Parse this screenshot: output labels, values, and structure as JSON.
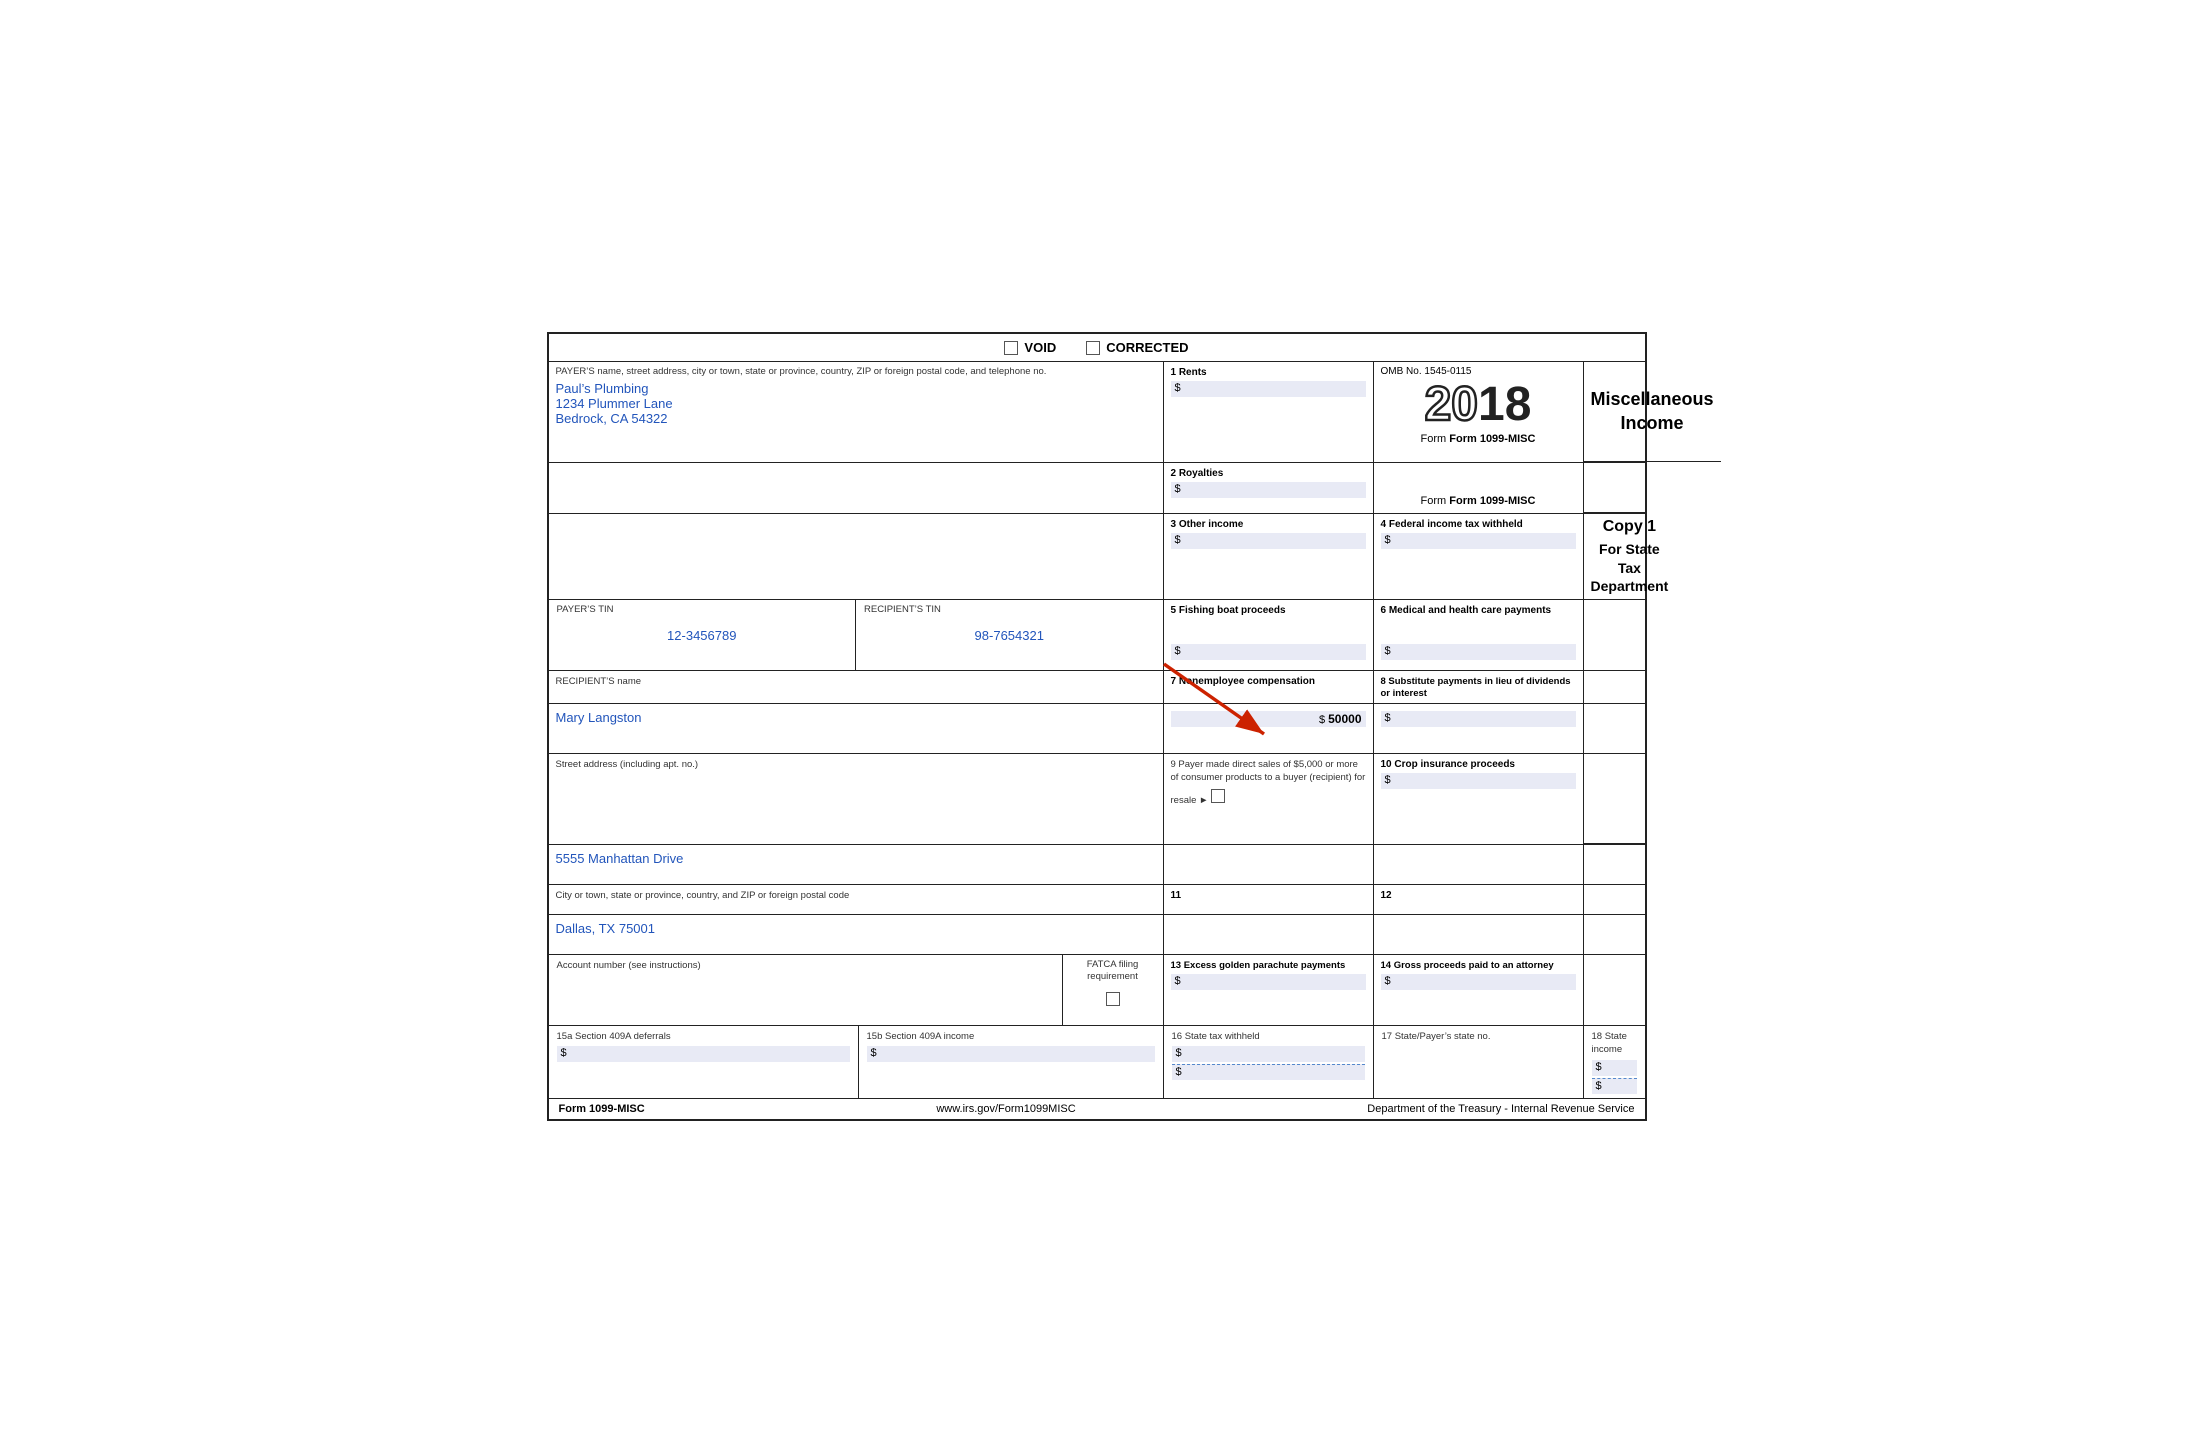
{
  "header": {
    "void_label": "VOID",
    "corrected_label": "CORRECTED"
  },
  "form": {
    "title_line1": "Miscellaneous",
    "title_line2": "Income",
    "copy_label": "Copy 1",
    "copy_sublabel": "For State Tax Department",
    "year_outline": "20",
    "year_solid": "18",
    "form_name": "Form 1099-MISC",
    "omb_label": "OMB No. 1545-0115",
    "payer_section_label": "PAYER’S name, street address, city or town, state or province, country, ZIP or foreign postal code, and telephone no.",
    "payer_name": "Paul’s Plumbing",
    "payer_address": "1234 Plummer Lane",
    "payer_city": "Bedrock, CA 54322",
    "payer_tin_label": "PAYER’S TIN",
    "payer_tin_value": "12-3456789",
    "recipient_tin_label": "RECIPIENT’S TIN",
    "recipient_tin_value": "98-7654321",
    "recipient_name_label": "RECIPIENT’S name",
    "recipient_name_value": "Mary Langston",
    "street_label": "Street address (including apt. no.)",
    "street_value": "5555 Manhattan Drive",
    "city_label": "City or town, state or province, country, and ZIP or foreign postal code",
    "city_value": "Dallas, TX 75001",
    "account_label": "Account number (see instructions)",
    "fatca_label": "FATCA filing requirement",
    "box1_label": "1 Rents",
    "box1_dollar": "$",
    "box2_label": "2 Royalties",
    "box2_dollar": "$",
    "box3_label": "3 Other income",
    "box3_dollar": "$",
    "box4_label": "4 Federal income tax withheld",
    "box4_dollar": "$",
    "box5_label": "5 Fishing boat proceeds",
    "box5_dollar": "$",
    "box6_label": "6 Medical and health care payments",
    "box6_dollar": "$",
    "box7_label": "7 Nonemployee compensation",
    "box7_dollar": "$",
    "box7_value": "50000",
    "box8_label": "8 Substitute payments in lieu of dividends or interest",
    "box8_dollar": "$",
    "box9_label": "9 Payer made direct sales of $5,000 or more of consumer products to a buyer (recipient) for resale ►",
    "box10_label": "10 Crop insurance proceeds",
    "box10_dollar": "$",
    "box11_label": "11",
    "box12_label": "12",
    "box13_label": "13 Excess golden parachute payments",
    "box13_dollar": "$",
    "box14_label": "14 Gross proceeds paid to an attorney",
    "box14_dollar": "$",
    "box15a_label": "15a Section 409A deferrals",
    "box15a_dollar": "$",
    "box15b_label": "15b Section 409A income",
    "box15b_dollar": "$",
    "box16_label": "16 State tax withheld",
    "box16_dollar1": "$",
    "box16_dollar2": "$",
    "box17_label": "17 State/Payer’s state no.",
    "box18_label": "18 State income",
    "box18_dollar1": "$",
    "box18_dollar2": "$",
    "footer_form": "Form 1099-MISC",
    "footer_url": "www.irs.gov/Form1099MISC",
    "footer_dept": "Department of the Treasury - Internal Revenue Service"
  }
}
